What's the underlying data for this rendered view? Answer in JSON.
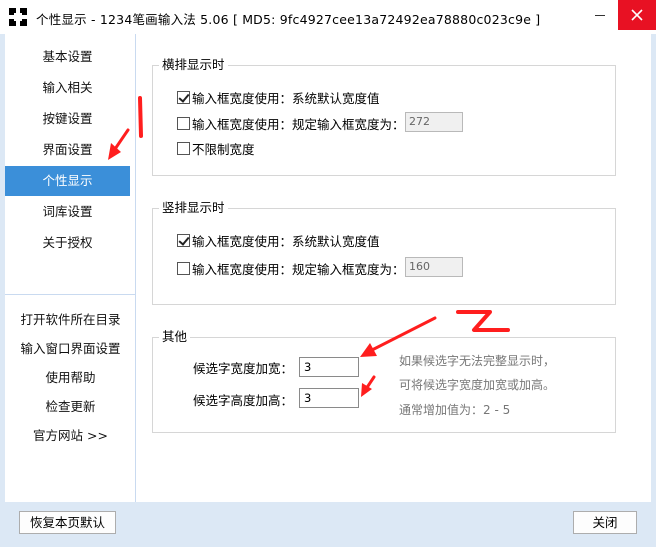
{
  "window": {
    "title": "个性显示 - 1234笔画输入法 5.06  [ MD5: 9fc4927cee13a72492ea78880c023c9e ]",
    "close_color": "#e81123"
  },
  "sidebar": {
    "items": [
      {
        "label": "基本设置"
      },
      {
        "label": "输入相关"
      },
      {
        "label": "按键设置"
      },
      {
        "label": "界面设置"
      },
      {
        "label": "个性显示"
      },
      {
        "label": "词库设置"
      },
      {
        "label": "关于授权"
      }
    ],
    "active_index": 4,
    "active_color": "#3b8fd9",
    "links": [
      {
        "label": "打开软件所在目录"
      },
      {
        "label": "输入窗口界面设置"
      },
      {
        "label": "使用帮助"
      },
      {
        "label": "检查更新"
      },
      {
        "label": "官方网站 >>"
      }
    ]
  },
  "horizontal": {
    "title": "横排显示时",
    "opt_default": {
      "label": "输入框宽度使用：系统默认宽度值",
      "checked": true
    },
    "opt_custom": {
      "label": "输入框宽度使用：规定输入框宽度为：",
      "checked": false,
      "value": "272"
    },
    "opt_unlimited": {
      "label": "不限制宽度",
      "checked": false
    }
  },
  "vertical": {
    "title": "竖排显示时",
    "opt_default": {
      "label": "输入框宽度使用：系统默认宽度值",
      "checked": true
    },
    "opt_custom": {
      "label": "输入框宽度使用：规定输入框宽度为：",
      "checked": false,
      "value": "160"
    }
  },
  "other": {
    "title": "其他",
    "width_label": "候选字宽度加宽：",
    "width_value": "3",
    "height_label": "候选字高度加高：",
    "height_value": "3",
    "hint1": "如果候选字无法完整显示时，",
    "hint2": "可将候选字宽度加宽或加高。",
    "hint3": "通常增加值为：2 - 5"
  },
  "footer": {
    "reset_label": "恢复本页默认",
    "close_label": "关闭"
  },
  "annotations": {
    "color": "#ff1e1e",
    "mark1": "1",
    "mark2": "2"
  }
}
